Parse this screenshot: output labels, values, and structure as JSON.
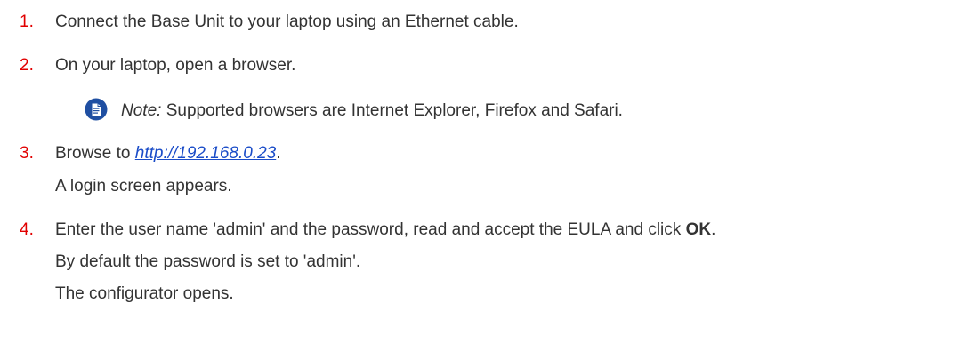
{
  "steps": [
    {
      "number": "1.",
      "text": "Connect the Base Unit to your laptop using an Ethernet cable."
    },
    {
      "number": "2.",
      "text": "On your laptop, open a browser.",
      "note": {
        "icon": "note-document-icon",
        "label": "Note:",
        "text": " Supported browsers are Internet Explorer, Firefox and Safari."
      }
    },
    {
      "number": "3.",
      "prefix": "Browse to ",
      "link": "http://192.168.0.23",
      "suffix": ".",
      "followup": "A login screen appears."
    },
    {
      "number": "4.",
      "text": "Enter the user name 'admin' and the password, read and accept the EULA and click ",
      "bold": "OK",
      "suffix": ".",
      "followups": [
        "By default the password is set to 'admin'.",
        "The configurator opens."
      ]
    }
  ],
  "colors": {
    "step_number": "#e10000",
    "link": "#1a4cc8",
    "text": "#333333",
    "note_icon": "#1f4fa2"
  }
}
